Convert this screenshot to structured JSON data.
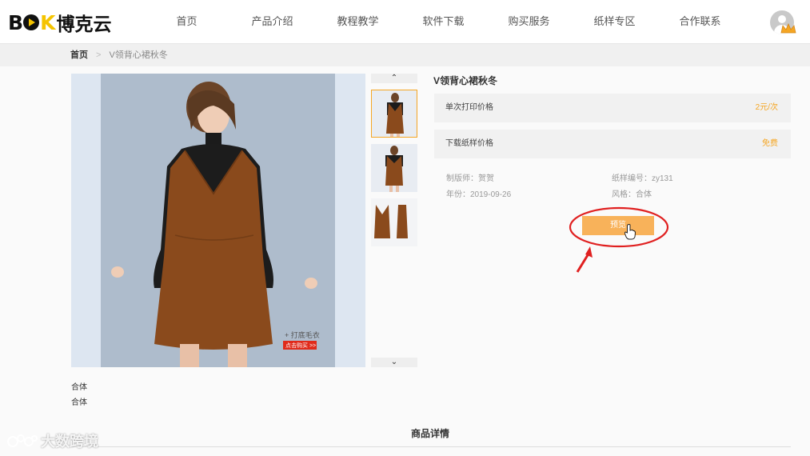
{
  "header": {
    "logo_latin": "B",
    "logo_k": "K",
    "logo_cn": "博克云",
    "nav": [
      "首页",
      "产品介绍",
      "教程教学",
      "软件下载",
      "购买服务",
      "纸样专区",
      "合作联系"
    ]
  },
  "breadcrumb": {
    "home": "首页",
    "separator": ">",
    "current": "V领背心裙秋冬"
  },
  "gallery": {
    "up_arrow": "⌃",
    "down_arrow": "⌄",
    "main_caption_1": "+ 打底毛衣",
    "main_caption_2": "点击购买 >>"
  },
  "product": {
    "title": "V领背心裙秋冬",
    "print_price_label": "单次打印价格",
    "print_price_value": "2元/次",
    "download_price_label": "下载纸样价格",
    "download_price_value": "免费",
    "designer": "制版师：贺贺",
    "year": "年份：2019-09-26",
    "pattern_no": "纸样编号：zy131",
    "style": "风格：合体",
    "preview_button": "预览"
  },
  "below": {
    "line1": "合体",
    "line2": "合体",
    "detail_title": "商品详情"
  },
  "watermark": "大数跨境",
  "colors": {
    "accent": "#f5a623",
    "button": "#f8b25a",
    "annotation": "#e02020",
    "logo_yellow": "#f5c400"
  }
}
